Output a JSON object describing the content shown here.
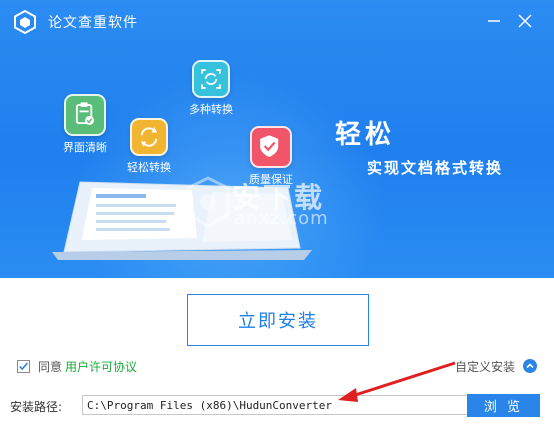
{
  "app": {
    "title": "论文查重软件",
    "minimize_icon": "minimize-icon",
    "close_icon": "close-icon"
  },
  "features": [
    {
      "label": "界面清晰",
      "icon": "clipboard-check-icon",
      "color": "#5bbd7a"
    },
    {
      "label": "轻松转换",
      "icon": "convert-arrows-icon",
      "color": "#f2b531"
    },
    {
      "label": "多种转换",
      "icon": "refresh-frame-icon",
      "color": "#36c2dc"
    },
    {
      "label": "质量保证",
      "icon": "shield-check-icon",
      "color": "#f0556a"
    }
  ],
  "slogan": {
    "title": "轻松",
    "subtitle": "实现文档格式转换"
  },
  "watermark": {
    "text": "安下载",
    "sub": "anxz.com"
  },
  "install_button": "立即安装",
  "agreement": {
    "checked": true,
    "text": "同意",
    "link": "用户许可协议"
  },
  "custom_install": "自定义安装",
  "install_path": {
    "label": "安装路径:",
    "value": "C:\\Program Files (x86)\\HudunConverter"
  },
  "browse_button": "浏 览",
  "colors": {
    "accent": "#2a85e8",
    "hero": "#1f7fee",
    "link": "#1aaa3a",
    "arrow": "#e02020"
  }
}
